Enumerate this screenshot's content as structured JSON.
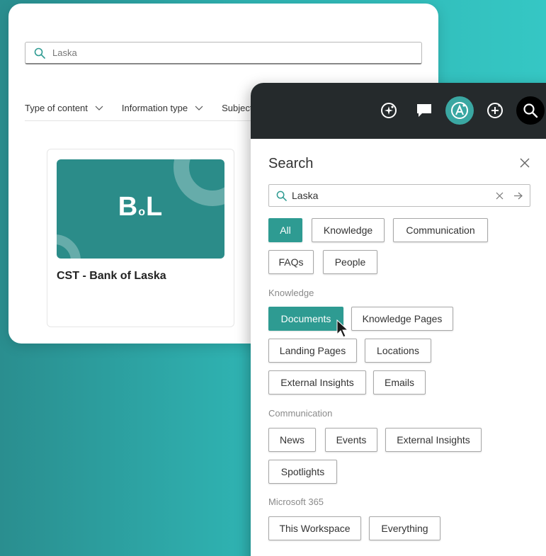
{
  "back": {
    "search_value": "Laska",
    "filters": [
      "Type of content",
      "Information type",
      "Subject"
    ],
    "card": {
      "logo_b": "B",
      "logo_o": "o",
      "logo_l": "L",
      "title": "CST - Bank of Laska"
    }
  },
  "toolbar": {
    "icons": [
      "ai-sparkle-icon",
      "chat-icon",
      "assistant-icon",
      "add-sparkle-icon",
      "search-icon"
    ],
    "accent": "#3aa7a2"
  },
  "panel": {
    "title": "Search",
    "search_value": "Laska",
    "tabs": {
      "all": "All",
      "knowledge": "Knowledge",
      "communication": "Communication",
      "faqs": "FAQs",
      "people": "People"
    },
    "sections": {
      "knowledge": "Knowledge",
      "communication": "Communication",
      "m365": "Microsoft 365"
    },
    "knowledge_chips": {
      "documents": "Documents",
      "knowledge_pages": "Knowledge Pages",
      "landing_pages": "Landing Pages",
      "locations": "Locations",
      "external_insights": "External Insights",
      "emails": "Emails"
    },
    "communication_chips": {
      "news": "News",
      "events": "Events",
      "external_insights": "External Insights",
      "spotlights": "Spotlights"
    },
    "m365_chips": {
      "this_workspace": "This Workspace",
      "everything": "Everything"
    },
    "active_color": "#2e9b92"
  }
}
